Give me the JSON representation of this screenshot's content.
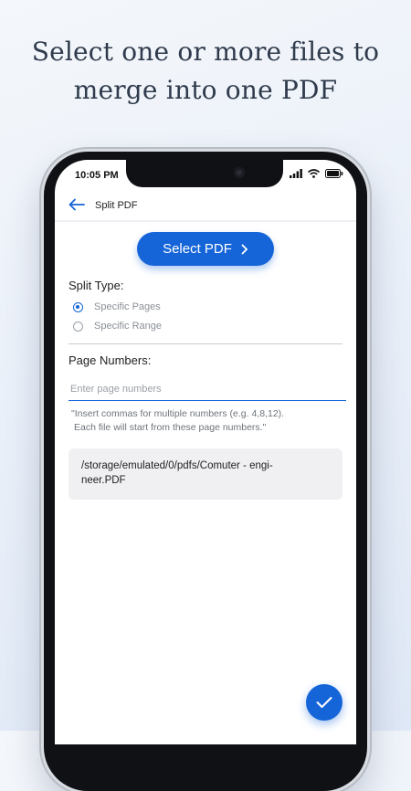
{
  "headline": {
    "line1": "Select one or more files to",
    "line2": "merge into one PDF"
  },
  "status_bar": {
    "time": "10:05 PM",
    "icons": [
      "signal-icon",
      "wifi-icon",
      "battery-icon"
    ]
  },
  "app_bar": {
    "title": "Split PDF",
    "back_icon": "arrow-left-icon"
  },
  "select_button": {
    "label": "Select PDF",
    "icon": "chevron-right-icon"
  },
  "split_type": {
    "label": "Split Type:",
    "options": [
      {
        "label": "Specific Pages",
        "selected": true
      },
      {
        "label": "Specific Range",
        "selected": false
      }
    ]
  },
  "page_numbers": {
    "label": "Page Numbers:",
    "placeholder": "Enter page numbers",
    "value": "",
    "hint_line1": "\"Insert commas for multiple numbers (e.g. 4,8,12).",
    "hint_line2": "Each file will start from these page numbers.\""
  },
  "file": {
    "path_line1": "/storage/emulated/0/pdfs/Comuter - engi-",
    "path_line2": "neer.PDF"
  },
  "fab": {
    "icon": "check-icon"
  },
  "colors": {
    "accent": "#1565d8",
    "card": "#f0f0f2"
  }
}
